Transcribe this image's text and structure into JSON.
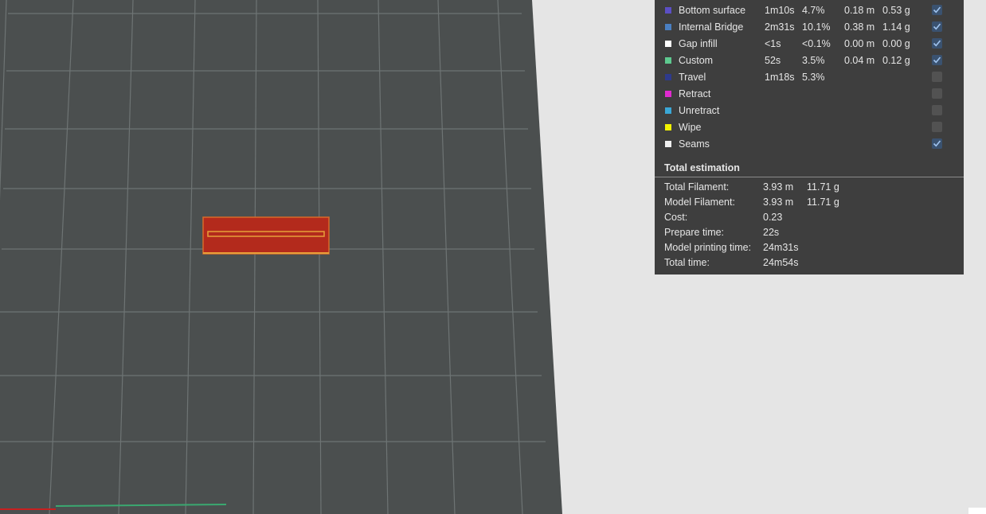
{
  "legend": {
    "features": [
      {
        "name": "Bottom surface",
        "time": "1m10s",
        "percent": "4.7%",
        "length": "0.18 m",
        "weight": "0.53 g",
        "color": "#5b4fc4",
        "checked": true
      },
      {
        "name": "Internal Bridge",
        "time": "2m31s",
        "percent": "10.1%",
        "length": "0.38 m",
        "weight": "1.14 g",
        "color": "#4a7fc1",
        "checked": true
      },
      {
        "name": "Gap infill",
        "time": "<1s",
        "percent": "<0.1%",
        "length": "0.00 m",
        "weight": "0.00 g",
        "color": "#ffffff",
        "checked": true
      },
      {
        "name": "Custom",
        "time": "52s",
        "percent": "3.5%",
        "length": "0.04 m",
        "weight": "0.12 g",
        "color": "#5ec98f",
        "checked": true
      },
      {
        "name": "Travel",
        "time": "1m18s",
        "percent": "5.3%",
        "length": "",
        "weight": "",
        "color": "#2e3a8c",
        "checked": false
      },
      {
        "name": "Retract",
        "time": "",
        "percent": "",
        "length": "",
        "weight": "",
        "color": "#e02ad0",
        "checked": false
      },
      {
        "name": "Unretract",
        "time": "",
        "percent": "",
        "length": "",
        "weight": "",
        "color": "#3aa7d6",
        "checked": false
      },
      {
        "name": "Wipe",
        "time": "",
        "percent": "",
        "length": "",
        "weight": "",
        "color": "#f2f200",
        "checked": false
      },
      {
        "name": "Seams",
        "time": "",
        "percent": "",
        "length": "",
        "weight": "",
        "color": "#f0f0f0",
        "checked": true
      }
    ],
    "total_title": "Total estimation",
    "summary": [
      {
        "label": "Total Filament:",
        "value": "3.93 m",
        "value2": "11.71 g"
      },
      {
        "label": "Model Filament:",
        "value": "3.93 m",
        "value2": "11.71 g"
      },
      {
        "label": "Cost:",
        "value": "0.23",
        "value2": ""
      },
      {
        "label": "Prepare time:",
        "value": "22s",
        "value2": ""
      },
      {
        "label": "Model printing time:",
        "value": "24m31s",
        "value2": ""
      },
      {
        "label": "Total time:",
        "value": "24m54s",
        "value2": ""
      }
    ]
  },
  "viewport": {
    "plate_color": "#4b4f4f",
    "grid_color": "#6e7474",
    "model_color": "#b32a1c",
    "model_outline_color": "#e8a03a"
  }
}
